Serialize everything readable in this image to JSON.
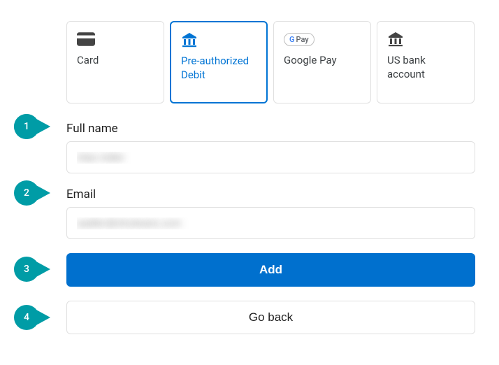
{
  "tabs": [
    {
      "id": "card",
      "label": "Card",
      "icon": "card-icon",
      "selected": false
    },
    {
      "id": "pad",
      "label": "Pre-authorized Debit",
      "icon": "bank-icon",
      "selected": true
    },
    {
      "id": "gpay",
      "label": "Google Pay",
      "icon": "gpay-badge",
      "selected": false
    },
    {
      "id": "usbank",
      "label": "US bank account",
      "icon": "bank-icon",
      "selected": false
    }
  ],
  "fields": {
    "fullname": {
      "label": "Full name",
      "value": "Alan Adler"
    },
    "email": {
      "label": "Email",
      "value": "aadler@shulware.com"
    }
  },
  "buttons": {
    "add": "Add",
    "goback": "Go back"
  },
  "markers": [
    "1",
    "2",
    "3",
    "4"
  ],
  "gpay_text": {
    "g": "G",
    "pay": "Pay"
  },
  "colors": {
    "accent": "#0074d4",
    "marker": "#009ca6"
  }
}
